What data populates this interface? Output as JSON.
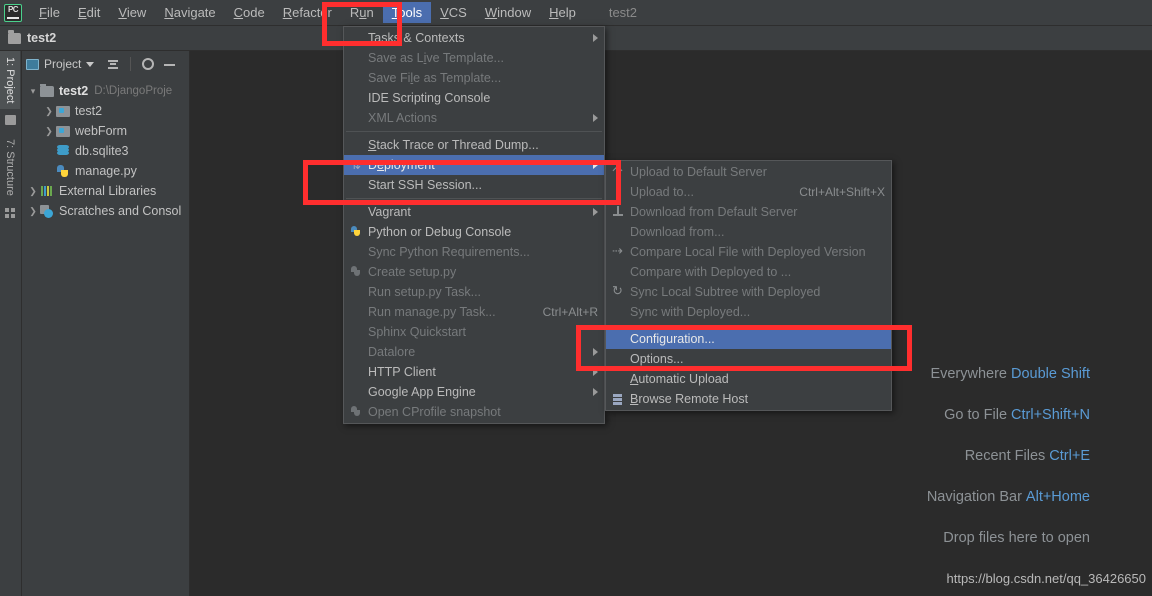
{
  "app": {
    "logo": "pycharm-logo",
    "project_title": "test2"
  },
  "menubar": {
    "items": [
      {
        "label": "File",
        "mnemonic": "F"
      },
      {
        "label": "Edit",
        "mnemonic": "E"
      },
      {
        "label": "View",
        "mnemonic": "V"
      },
      {
        "label": "Navigate",
        "mnemonic": "N"
      },
      {
        "label": "Code",
        "mnemonic": "C"
      },
      {
        "label": "Refactor",
        "mnemonic": "R"
      },
      {
        "label": "Run",
        "mnemonic": "u"
      },
      {
        "label": "Tools",
        "mnemonic": "T",
        "active": true
      },
      {
        "label": "VCS",
        "mnemonic": "V"
      },
      {
        "label": "Window",
        "mnemonic": "W"
      },
      {
        "label": "Help",
        "mnemonic": "H"
      }
    ],
    "title": "test2"
  },
  "breadcrumb": {
    "icon": "folder-icon",
    "label": "test2"
  },
  "toolstrip": {
    "project_tab": "1: Project",
    "structure_tab": "7: Structure"
  },
  "project_panel": {
    "header": {
      "title": "Project",
      "collapse_all": "collapse-all-button",
      "settings": "gear-button",
      "hide": "hide-button"
    },
    "tree": [
      {
        "label": "test2",
        "sub": "D:\\DjangoProje",
        "icon": "folder-icon",
        "arrow": "v",
        "bold": true,
        "indent": 0
      },
      {
        "label": "test2",
        "sub": "",
        "icon": "module-folder-icon",
        "arrow": ">",
        "bold": false,
        "indent": 1
      },
      {
        "label": "webForm",
        "sub": "",
        "icon": "module-folder-icon",
        "arrow": ">",
        "bold": false,
        "indent": 1
      },
      {
        "label": "db.sqlite3",
        "sub": "",
        "icon": "database-icon",
        "arrow": "",
        "bold": false,
        "indent": 1
      },
      {
        "label": "manage.py",
        "sub": "",
        "icon": "python-file-icon",
        "arrow": "",
        "bold": false,
        "indent": 1
      },
      {
        "label": "External Libraries",
        "sub": "",
        "icon": "library-icon",
        "arrow": ">",
        "bold": false,
        "indent": 0
      },
      {
        "label": "Scratches and Consol",
        "sub": "",
        "icon": "scratches-icon",
        "arrow": ">",
        "bold": false,
        "indent": 0
      }
    ]
  },
  "tools_menu": {
    "items": [
      {
        "label": "Tasks & Contexts",
        "mnemonic": "T",
        "disabled": false,
        "submenu": true,
        "icon": "",
        "accel": ""
      },
      {
        "label": "Save as Live Template...",
        "mnemonic": "i",
        "disabled": true,
        "submenu": false,
        "icon": "",
        "accel": ""
      },
      {
        "label": "Save File as Template...",
        "mnemonic": "l",
        "disabled": true,
        "submenu": false,
        "icon": "",
        "accel": ""
      },
      {
        "label": "IDE Scripting Console",
        "mnemonic": "",
        "disabled": false,
        "submenu": false,
        "icon": "",
        "accel": ""
      },
      {
        "label": "XML Actions",
        "mnemonic": "",
        "disabled": true,
        "submenu": true,
        "icon": "",
        "accel": ""
      },
      {
        "sep": true
      },
      {
        "label": "Stack Trace or Thread Dump...",
        "mnemonic": "S",
        "disabled": false,
        "submenu": false,
        "icon": "",
        "accel": ""
      },
      {
        "label": "Deployment",
        "mnemonic": "e",
        "disabled": false,
        "submenu": true,
        "selected": true,
        "icon": "deployment-icon",
        "accel": ""
      },
      {
        "label": "Start SSH Session...",
        "mnemonic": "",
        "disabled": false,
        "submenu": false,
        "icon": "",
        "accel": ""
      },
      {
        "sep": true
      },
      {
        "label": "Vagrant",
        "mnemonic": "",
        "disabled": false,
        "submenu": true,
        "icon": "",
        "accel": ""
      },
      {
        "label": "Python or Debug Console",
        "mnemonic": "",
        "disabled": false,
        "submenu": false,
        "icon": "python-icon",
        "accel": ""
      },
      {
        "label": "Sync Python Requirements...",
        "mnemonic": "",
        "disabled": true,
        "submenu": false,
        "icon": "",
        "accel": ""
      },
      {
        "label": "Create setup.py",
        "mnemonic": "",
        "disabled": true,
        "submenu": false,
        "icon": "python-grey-icon",
        "accel": ""
      },
      {
        "label": "Run setup.py Task...",
        "mnemonic": "",
        "disabled": true,
        "submenu": false,
        "icon": "",
        "accel": ""
      },
      {
        "label": "Run manage.py Task...",
        "mnemonic": "",
        "disabled": true,
        "submenu": false,
        "icon": "",
        "accel": "Ctrl+Alt+R"
      },
      {
        "label": "Sphinx Quickstart",
        "mnemonic": "",
        "disabled": true,
        "submenu": false,
        "icon": "",
        "accel": ""
      },
      {
        "label": "Datalore",
        "mnemonic": "",
        "disabled": true,
        "submenu": true,
        "icon": "",
        "accel": ""
      },
      {
        "label": "HTTP Client",
        "mnemonic": "",
        "disabled": false,
        "submenu": true,
        "icon": "",
        "accel": ""
      },
      {
        "label": "Google App Engine",
        "mnemonic": "",
        "disabled": false,
        "submenu": true,
        "icon": "",
        "accel": ""
      },
      {
        "label": "Open CProfile snapshot",
        "mnemonic": "",
        "disabled": true,
        "submenu": false,
        "icon": "python-grey-icon",
        "accel": ""
      }
    ]
  },
  "deployment_submenu": {
    "items": [
      {
        "label": "Upload to Default Server",
        "mnemonic": "",
        "disabled": true,
        "icon": "upload-icon",
        "accel": ""
      },
      {
        "label": "Upload to...",
        "mnemonic": "",
        "disabled": true,
        "icon": "",
        "accel": "Ctrl+Alt+Shift+X"
      },
      {
        "label": "Download from Default Server",
        "mnemonic": "",
        "disabled": true,
        "icon": "download-icon",
        "accel": ""
      },
      {
        "label": "Download from...",
        "mnemonic": "",
        "disabled": true,
        "icon": "",
        "accel": ""
      },
      {
        "label": "Compare Local File with Deployed Version",
        "mnemonic": "",
        "disabled": true,
        "icon": "compare-icon",
        "accel": ""
      },
      {
        "label": "Compare with Deployed to ...",
        "mnemonic": "",
        "disabled": true,
        "icon": "",
        "accel": ""
      },
      {
        "label": "Sync Local Subtree with Deployed",
        "mnemonic": "",
        "disabled": true,
        "icon": "sync-icon",
        "accel": ""
      },
      {
        "label": "Sync with Deployed...",
        "mnemonic": "",
        "disabled": true,
        "icon": "",
        "accel": ""
      },
      {
        "sep": true
      },
      {
        "label": "Configuration...",
        "mnemonic": "",
        "disabled": false,
        "selected": true,
        "icon": "",
        "accel": ""
      },
      {
        "label": "Options...",
        "mnemonic": "",
        "disabled": false,
        "icon": "",
        "accel": ""
      },
      {
        "label": "Automatic Upload",
        "mnemonic": "A",
        "disabled": false,
        "icon": "",
        "accel": ""
      },
      {
        "label": "Browse Remote Host",
        "mnemonic": "B",
        "disabled": false,
        "icon": "remote-host-icon",
        "accel": ""
      }
    ]
  },
  "editor_hints": {
    "rows": [
      {
        "text": "Everywhere",
        "key": "Double Shift"
      },
      {
        "text": "Go to File",
        "key": "Ctrl+Shift+N"
      },
      {
        "text": "Recent Files",
        "key": "Ctrl+E"
      },
      {
        "text": "Navigation Bar",
        "key": "Alt+Home"
      },
      {
        "text": "Drop files here to open",
        "key": ""
      }
    ],
    "watermark": "https://blog.csdn.net/qq_36426650"
  },
  "annotations": {
    "highlight_color": "#ff2e2e",
    "boxes": [
      "tools-menu-highlight",
      "deployment-item-highlight",
      "configuration-item-highlight"
    ]
  },
  "colors": {
    "menu_bg": "#3c3f41",
    "editor_bg": "#2b2b2b",
    "selection_blue": "#4b6eaf",
    "hint_key_blue": "#5a9bd5"
  }
}
